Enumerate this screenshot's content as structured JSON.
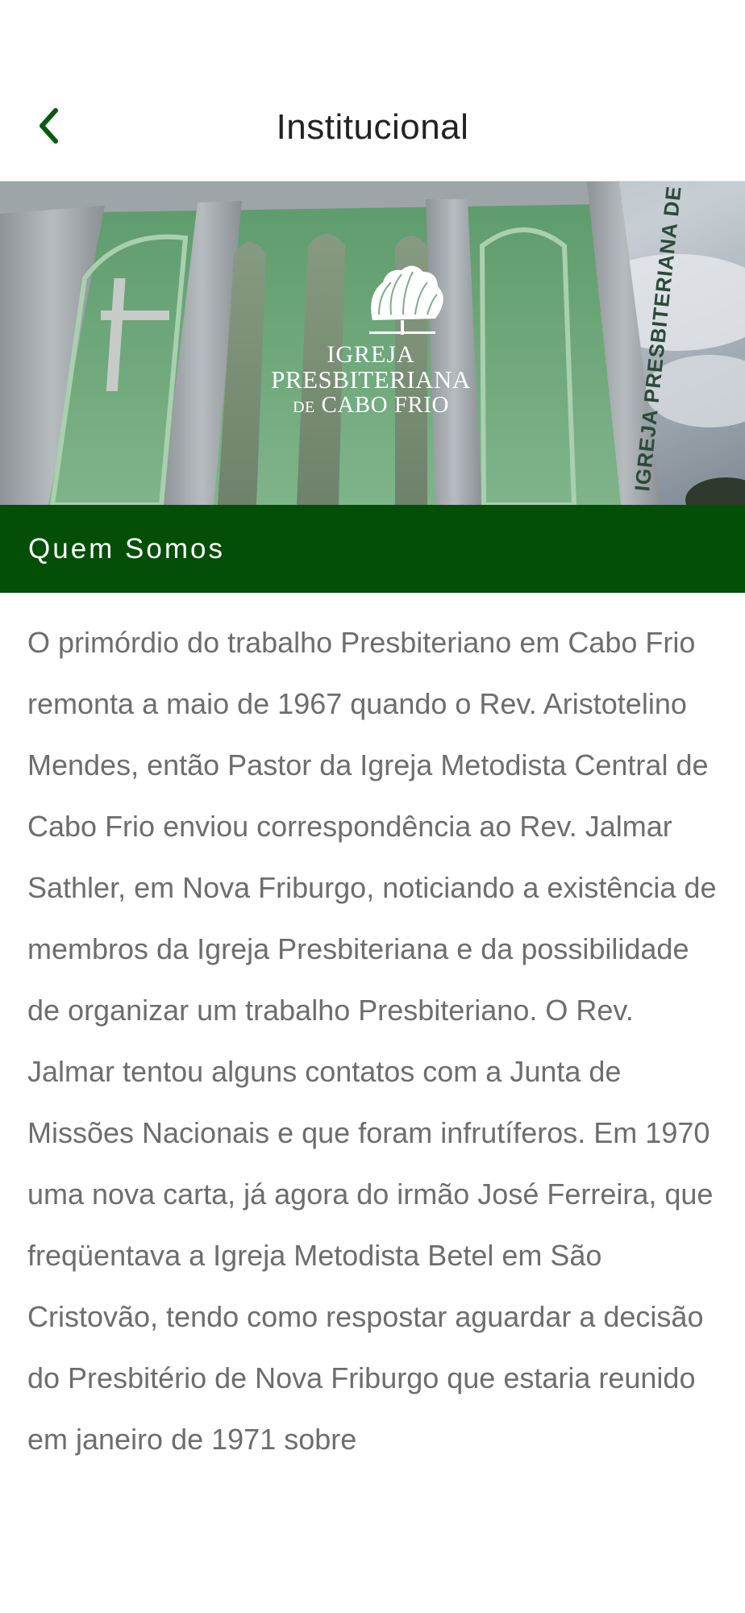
{
  "nav": {
    "title": "Institucional",
    "back_icon": "chevron-left-icon"
  },
  "hero": {
    "logo_icon": "wheat-sheaf-icon",
    "logo_line1": "IGREJA",
    "logo_line2": "PRESBITERIANA",
    "logo_line3_prefix": "DE",
    "logo_line3": "CABO FRIO",
    "building_sign": "IGREJA PRESBITERIANA DE CABO"
  },
  "section": {
    "title": "Quem Somos"
  },
  "content": {
    "text": "O primórdio do trabalho Presbiteriano em Cabo Frio remonta a maio de 1967 quando o Rev. Aristotelino Mendes, então Pastor da Igreja Metodista Central de Cabo Frio enviou correspondência ao Rev. Jalmar Sathler, em Nova Friburgo, noticiando a existência de membros da Igreja Presbiteriana e da possibilidade de organizar um trabalho Presbiteriano. O Rev. Jalmar tentou alguns contatos com a Junta de Missões Nacionais e que foram infrutíferos. Em 1970 uma nova carta, já agora do irmão José Ferreira, que freqüentava a Igreja Metodista Betel em São Cristovão, tendo como respostar aguardar a decisão do Presbitério de Nova Friburgo que estaria reunido em janeiro de 1971 sobre"
  },
  "colors": {
    "accent_green": "#044f07",
    "back_icon": "#0a5a0f",
    "body_text": "#6d6d6d"
  }
}
